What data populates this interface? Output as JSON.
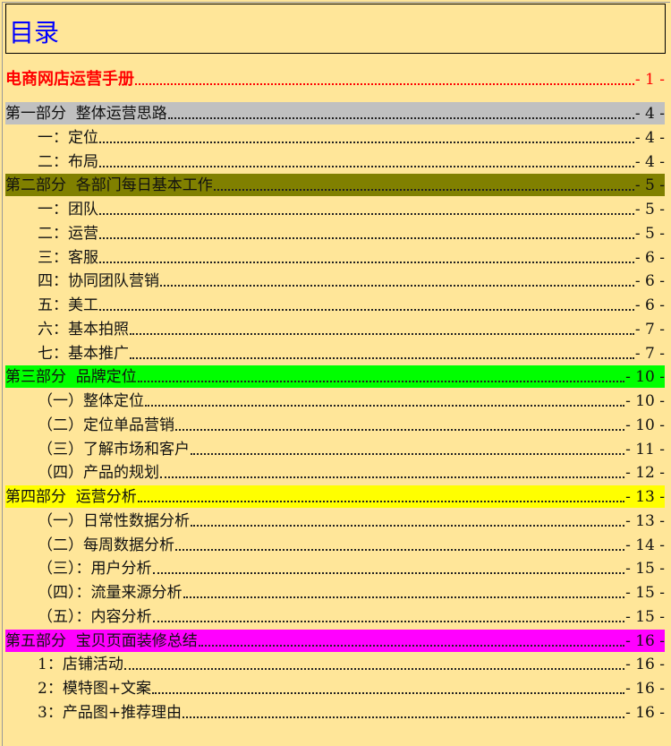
{
  "title": "目录",
  "colors": {
    "background": "#FFE699",
    "part1": "#C0C0C0",
    "part2": "#808000",
    "part3": "#00FF00",
    "part4": "#FFFF00",
    "part5": "#FF00FF",
    "main": "#FF0000",
    "title": "#0000FF"
  },
  "entries": [
    {
      "label": "电商网店运营手册",
      "page": "- 1 -",
      "level": "main"
    },
    {
      "label": "第一部分  整体运营思路",
      "page": "- 4 -",
      "level": "part",
      "color": "#C0C0C0"
    },
    {
      "label": "一：定位",
      "page": "- 4 -",
      "level": "l2"
    },
    {
      "label": "二：布局",
      "page": "- 4 -",
      "level": "l2"
    },
    {
      "label": "第二部分  各部门每日基本工作",
      "page": "- 5 -",
      "level": "part",
      "color": "#808000"
    },
    {
      "label": "一：团队",
      "page": "- 5 -",
      "level": "l2"
    },
    {
      "label": "二：运营",
      "page": "- 5 -",
      "level": "l2"
    },
    {
      "label": "三：客服",
      "page": "- 6 -",
      "level": "l2"
    },
    {
      "label": "四：协同团队营销",
      "page": "- 6 -",
      "level": "l2"
    },
    {
      "label": "五：美工",
      "page": "- 6 -",
      "level": "l2"
    },
    {
      "label": "六：基本拍照",
      "page": "- 7 -",
      "level": "l2"
    },
    {
      "label": "七：基本推广",
      "page": "- 7 -",
      "level": "l2"
    },
    {
      "label": "第三部分  品牌定位",
      "page": "- 10 -",
      "level": "part",
      "color": "#00FF00"
    },
    {
      "label": "（一）整体定位",
      "page": "- 10 -",
      "level": "l2"
    },
    {
      "label": "（二）定位单品营销",
      "page": "- 10 -",
      "level": "l2"
    },
    {
      "label": "（三）了解市场和客户",
      "page": "- 11 -",
      "level": "l2"
    },
    {
      "label": "（四）产品的规划",
      "page": "- 12 -",
      "level": "l2"
    },
    {
      "label": "第四部分  运营分析",
      "page": "- 13 -",
      "level": "part",
      "color": "#FFFF00"
    },
    {
      "label": "（一）日常性数据分析",
      "page": "- 13 -",
      "level": "l2"
    },
    {
      "label": "（二）每周数据分析",
      "page": "- 14 -",
      "level": "l2"
    },
    {
      "label": "（三）：用户分析",
      "page": "- 15 -",
      "level": "l2"
    },
    {
      "label": "（四）：流量来源分析",
      "page": "- 15 -",
      "level": "l2"
    },
    {
      "label": "（五）：内容分析",
      "page": "- 15 -",
      "level": "l2"
    },
    {
      "label": "第五部分  宝贝页面装修总结",
      "page": "- 16 -",
      "level": "part",
      "color": "#FF00FF"
    },
    {
      "label": "1：店铺活动",
      "page": "- 16 -",
      "level": "l2"
    },
    {
      "label": "2：模特图+文案",
      "page": "- 16 -",
      "level": "l2"
    },
    {
      "label": "3：产品图+推荐理由",
      "page": "- 16 -",
      "level": "l2"
    }
  ]
}
